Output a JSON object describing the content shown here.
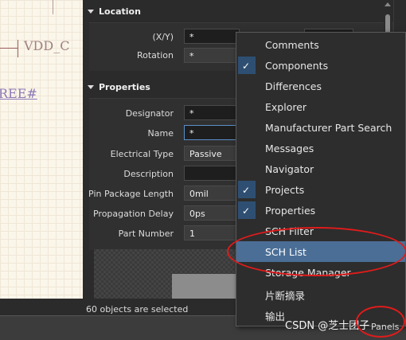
{
  "canvas": {
    "vdd_text": "VDD_C",
    "ree_text": "REE#"
  },
  "location": {
    "title": "Location",
    "rows": [
      {
        "label": "(X/Y)",
        "value": "*"
      },
      {
        "label": "Rotation",
        "value": "*"
      }
    ]
  },
  "properties": {
    "title": "Properties",
    "rows": [
      {
        "label": "Designator",
        "value": "*"
      },
      {
        "label": "Name",
        "value": "*"
      },
      {
        "label": "Electrical Type",
        "value": "Passive"
      },
      {
        "label": "Description",
        "value": ""
      },
      {
        "label": "Pin Package Length",
        "value": "0mil"
      },
      {
        "label": "Propagation Delay",
        "value": "0ps"
      },
      {
        "label": "Part Number",
        "value": "1"
      }
    ]
  },
  "status": {
    "selection": "60 objects are selected"
  },
  "menu": {
    "items": [
      {
        "label": "Comments",
        "checked": false
      },
      {
        "label": "Components",
        "checked": true
      },
      {
        "label": "Differences",
        "checked": false
      },
      {
        "label": "Explorer",
        "checked": false
      },
      {
        "label": "Manufacturer Part Search",
        "checked": false
      },
      {
        "label": "Messages",
        "checked": false
      },
      {
        "label": "Navigator",
        "checked": false
      },
      {
        "label": "Projects",
        "checked": true
      },
      {
        "label": "Properties",
        "checked": true
      },
      {
        "label": "SCH Filter",
        "checked": false
      },
      {
        "label": "SCH List",
        "checked": false,
        "highlighted": true
      },
      {
        "label": "Storage Manager",
        "checked": false
      },
      {
        "label": "片断摘录",
        "checked": false
      },
      {
        "label": "输出",
        "checked": false
      }
    ]
  },
  "bottom": {
    "watermark": "CSDN @芝士团子",
    "panels_label": "Panels"
  },
  "colors": {
    "highlight": "#4b6e96",
    "annotation": "#e01b1b",
    "check_bg": "#2e4f72"
  }
}
